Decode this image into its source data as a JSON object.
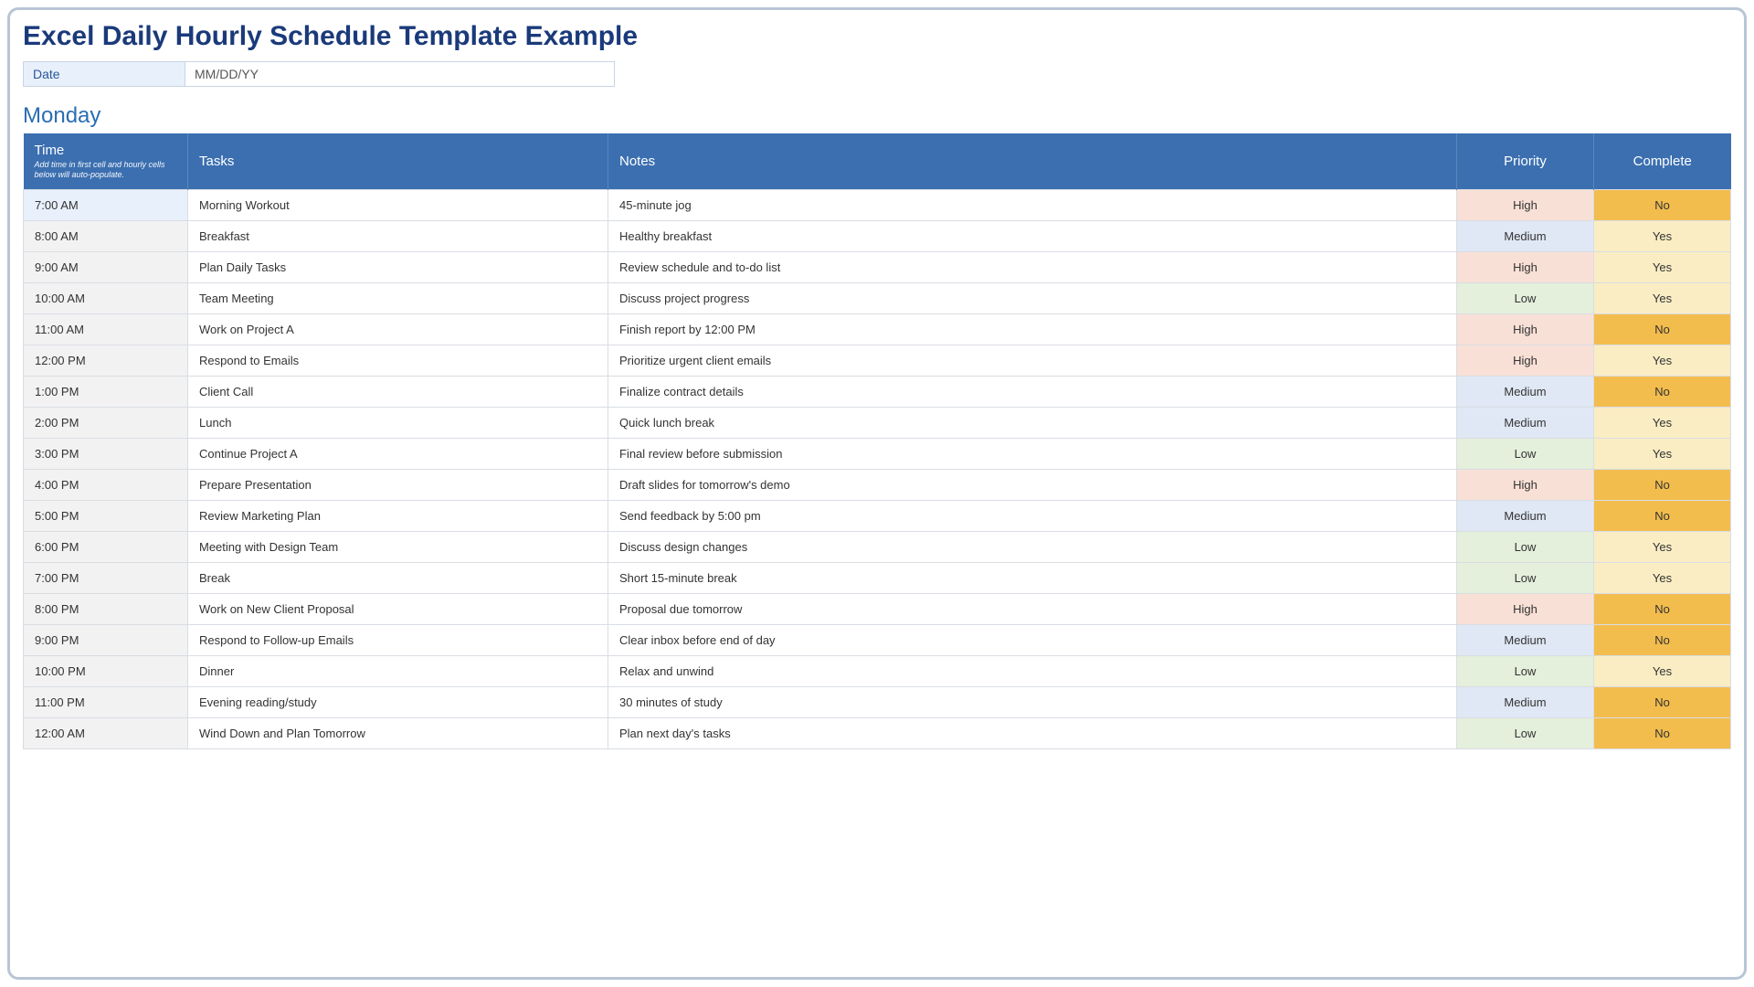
{
  "title": "Excel Daily Hourly Schedule Template Example",
  "date": {
    "label": "Date",
    "value": "MM/DD/YY"
  },
  "day": "Monday",
  "headers": {
    "time": "Time",
    "time_sub": "Add time in first cell and hourly cells below will auto-populate.",
    "tasks": "Tasks",
    "notes": "Notes",
    "priority": "Priority",
    "complete": "Complete"
  },
  "rows": [
    {
      "time": "7:00 AM",
      "task": "Morning Workout",
      "note": "45-minute jog",
      "priority": "High",
      "complete": "No"
    },
    {
      "time": "8:00 AM",
      "task": "Breakfast",
      "note": "Healthy breakfast",
      "priority": "Medium",
      "complete": "Yes"
    },
    {
      "time": "9:00 AM",
      "task": "Plan Daily Tasks",
      "note": "Review schedule and to-do list",
      "priority": "High",
      "complete": "Yes"
    },
    {
      "time": "10:00 AM",
      "task": "Team Meeting",
      "note": "Discuss project progress",
      "priority": "Low",
      "complete": "Yes"
    },
    {
      "time": "11:00 AM",
      "task": "Work on Project A",
      "note": "Finish report by 12:00 PM",
      "priority": "High",
      "complete": "No"
    },
    {
      "time": "12:00 PM",
      "task": "Respond to Emails",
      "note": "Prioritize urgent client emails",
      "priority": "High",
      "complete": "Yes"
    },
    {
      "time": "1:00 PM",
      "task": "Client Call",
      "note": "Finalize contract details",
      "priority": "Medium",
      "complete": "No"
    },
    {
      "time": "2:00 PM",
      "task": "Lunch",
      "note": "Quick lunch break",
      "priority": "Medium",
      "complete": "Yes"
    },
    {
      "time": "3:00 PM",
      "task": "Continue Project A",
      "note": "Final review before submission",
      "priority": "Low",
      "complete": "Yes"
    },
    {
      "time": "4:00 PM",
      "task": "Prepare Presentation",
      "note": "Draft slides for tomorrow's demo",
      "priority": "High",
      "complete": "No"
    },
    {
      "time": "5:00 PM",
      "task": "Review Marketing Plan",
      "note": "Send feedback by 5:00 pm",
      "priority": "Medium",
      "complete": "No"
    },
    {
      "time": "6:00 PM",
      "task": "Meeting with Design Team",
      "note": "Discuss design changes",
      "priority": "Low",
      "complete": "Yes"
    },
    {
      "time": "7:00 PM",
      "task": "Break",
      "note": "Short 15-minute break",
      "priority": "Low",
      "complete": "Yes"
    },
    {
      "time": "8:00 PM",
      "task": "Work on New Client Proposal",
      "note": "Proposal due tomorrow",
      "priority": "High",
      "complete": "No"
    },
    {
      "time": "9:00 PM",
      "task": "Respond to Follow-up Emails",
      "note": "Clear inbox before end of day",
      "priority": "Medium",
      "complete": "No"
    },
    {
      "time": "10:00 PM",
      "task": "Dinner",
      "note": "Relax and unwind",
      "priority": "Low",
      "complete": "Yes"
    },
    {
      "time": "11:00 PM",
      "task": "Evening reading/study",
      "note": "30 minutes of study",
      "priority": "Medium",
      "complete": "No"
    },
    {
      "time": "12:00 AM",
      "task": "Wind Down and Plan Tomorrow",
      "note": "Plan next day's tasks",
      "priority": "Low",
      "complete": "No"
    }
  ],
  "colors": {
    "priority": {
      "High": "pr-high",
      "Medium": "pr-medium",
      "Low": "pr-low"
    },
    "complete": {
      "Yes": "cp-yes",
      "No": "cp-no"
    }
  }
}
